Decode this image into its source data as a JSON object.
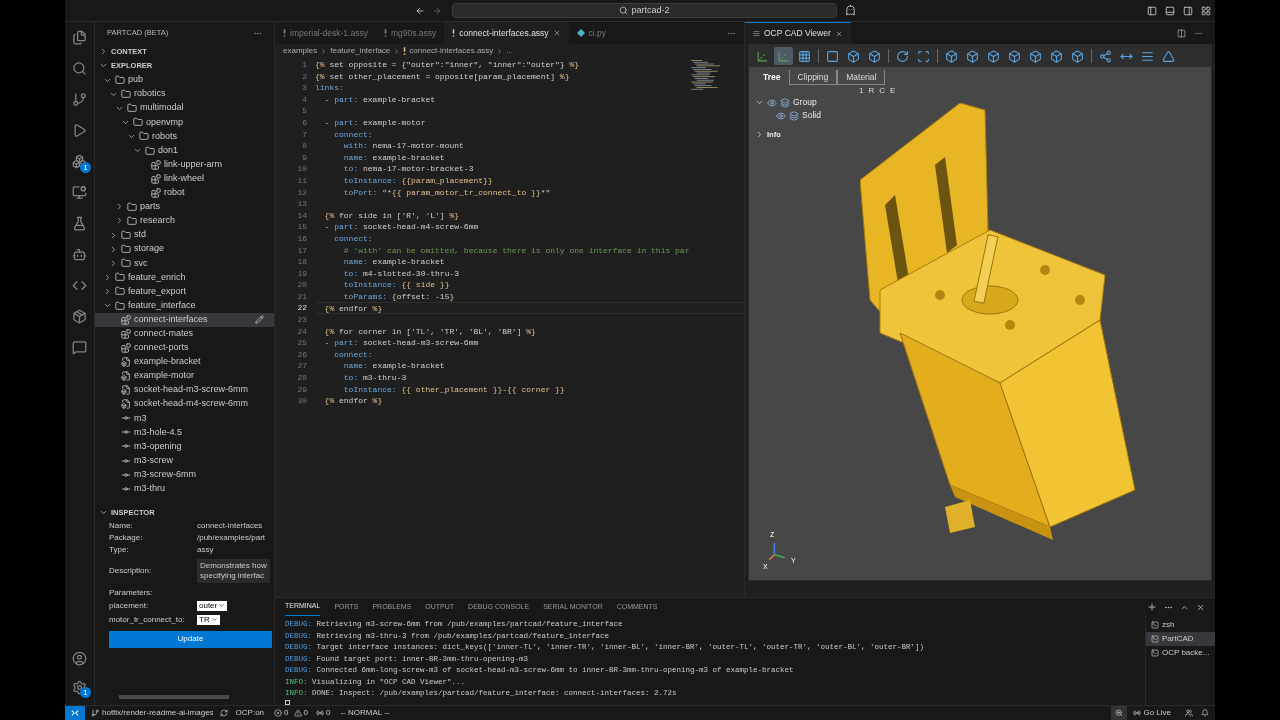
{
  "title_bar": {
    "search": "partcad-2"
  },
  "activity_bar": {
    "extensions_badge": "1",
    "settings_badge": "1"
  },
  "sidebar": {
    "title": "PARTCAD (BETA)",
    "sections": [
      {
        "label": "CONTEXT",
        "expanded": false
      },
      {
        "label": "EXPLORER",
        "expanded": true
      }
    ],
    "tree": [
      {
        "label": "pub",
        "kind": "folder",
        "expanded": true,
        "selected": false,
        "children": [
          {
            "label": "robotics",
            "kind": "folder",
            "expanded": true,
            "selected": false,
            "children": [
              {
                "label": "multimodal",
                "kind": "folder",
                "expanded": true,
                "selected": false,
                "children": [
                  {
                    "label": "openvmp",
                    "kind": "folder",
                    "expanded": true,
                    "selected": false,
                    "children": [
                      {
                        "label": "robots",
                        "kind": "folder",
                        "expanded": true,
                        "selected": false,
                        "children": [
                          {
                            "label": "don1",
                            "kind": "folder",
                            "expanded": true,
                            "selected": false,
                            "children": [
                              {
                                "label": "link-upper-arm",
                                "kind": "assembly",
                                "selected": false
                              },
                              {
                                "label": "link-wheel",
                                "kind": "assembly",
                                "selected": false
                              },
                              {
                                "label": "robot",
                                "kind": "assembly",
                                "selected": false
                              }
                            ]
                          }
                        ]
                      }
                    ]
                  }
                ]
              },
              {
                "label": "parts",
                "kind": "folder",
                "expanded": false,
                "selected": false
              },
              {
                "label": "research",
                "kind": "folder",
                "expanded": false,
                "selected": false
              }
            ]
          },
          {
            "label": "std",
            "kind": "folder",
            "expanded": false,
            "selected": false
          },
          {
            "label": "storage",
            "kind": "folder",
            "expanded": false,
            "selected": false
          },
          {
            "label": "svc",
            "kind": "folder",
            "expanded": false,
            "selected": false
          }
        ]
      },
      {
        "label": "feature_enrich",
        "kind": "folder",
        "expanded": false,
        "selected": false
      },
      {
        "label": "feature_export",
        "kind": "folder",
        "expanded": false,
        "selected": false
      },
      {
        "label": "feature_interface",
        "kind": "folder",
        "expanded": true,
        "selected": false,
        "children": [
          {
            "label": "connect-interfaces",
            "kind": "assembly",
            "selected": true
          },
          {
            "label": "connect-mates",
            "kind": "assembly",
            "selected": false
          },
          {
            "label": "connect-ports",
            "kind": "assembly",
            "selected": false
          },
          {
            "label": "example-bracket",
            "kind": "part",
            "selected": false
          },
          {
            "label": "example-motor",
            "kind": "part",
            "selected": false
          },
          {
            "label": "socket-head-m3-screw-6mm",
            "kind": "part",
            "selected": false
          },
          {
            "label": "socket-head-m4-screw-6mm",
            "kind": "part",
            "selected": false
          },
          {
            "label": "m3",
            "kind": "interface",
            "selected": false
          },
          {
            "label": "m3-hole-4.5",
            "kind": "interface",
            "selected": false
          },
          {
            "label": "m3-opening",
            "kind": "interface",
            "selected": false
          },
          {
            "label": "m3-screw",
            "kind": "interface",
            "selected": false
          },
          {
            "label": "m3-screw-6mm",
            "kind": "interface",
            "selected": false
          },
          {
            "label": "m3-thru",
            "kind": "interface",
            "selected": false
          }
        ]
      }
    ],
    "inspector": {
      "label": "INSPECTOR",
      "expanded": true,
      "fields": [
        {
          "label": "Name:",
          "value": "connect-interfaces"
        },
        {
          "label": "Package:",
          "value": "/pub/examples/part"
        },
        {
          "label": "Type:",
          "value": "assy"
        }
      ],
      "description": {
        "label": "Description:",
        "lines": [
          "Demonstrates how",
          "specifying interfac"
        ]
      },
      "parameters_label": "Parameters:",
      "parameters": [
        {
          "label": "placement:",
          "value": "outer"
        },
        {
          "label": "motor_tr_connect_to:",
          "value": "TR"
        }
      ],
      "button": "Update"
    }
  },
  "editor": {
    "tabs": [
      {
        "label": "imperial-desk-1.assy",
        "kind": "yaml",
        "selected": false
      },
      {
        "label": "mg90s.assy",
        "kind": "yaml",
        "selected": false
      },
      {
        "label": "connect-interfaces.assy",
        "kind": "yaml",
        "selected": true
      },
      {
        "label": "ci.py",
        "kind": "python",
        "selected": false
      }
    ],
    "breadcrumbs": [
      {
        "label": "examples",
        "kind": "folder"
      },
      {
        "label": "feature_interface",
        "kind": "folder"
      },
      {
        "label": "connect-interfaces.assy",
        "kind": "yaml"
      },
      {
        "label": "...",
        "kind": "folder"
      }
    ],
    "lines": [
      {
        "n": "1",
        "current": false,
        "tokens": [
          {
            "kind": "tpl",
            "text": "{%"
          },
          {
            "kind": "text",
            "text": " set opposite = {\"outer\":\"inner\", \"inner\":\"outer\"} "
          },
          {
            "kind": "tpl",
            "text": "%}"
          }
        ]
      },
      {
        "n": "2",
        "current": false,
        "tokens": [
          {
            "kind": "tpl",
            "text": "{%"
          },
          {
            "kind": "text",
            "text": " set other_placement = opposite[param_placement] "
          },
          {
            "kind": "tpl",
            "text": "%}"
          }
        ]
      },
      {
        "n": "3",
        "current": false,
        "tokens": [
          {
            "kind": "key",
            "text": "links:"
          }
        ]
      },
      {
        "n": "4",
        "current": false,
        "tokens": [
          {
            "kind": "text",
            "text": "  - "
          },
          {
            "kind": "key",
            "text": "part:"
          },
          {
            "kind": "text",
            "text": " example-bracket"
          }
        ]
      },
      {
        "n": "5",
        "current": false
      },
      {
        "n": "6",
        "current": false,
        "tokens": [
          {
            "kind": "text",
            "text": "  - "
          },
          {
            "kind": "key",
            "text": "part:"
          },
          {
            "kind": "text",
            "text": " example-motor"
          }
        ]
      },
      {
        "n": "7",
        "current": false,
        "tokens": [
          {
            "kind": "key",
            "text": "    connect:"
          }
        ]
      },
      {
        "n": "8",
        "current": false,
        "tokens": [
          {
            "kind": "key",
            "text": "      with:"
          },
          {
            "kind": "text",
            "text": " nema-17-motor-mount"
          }
        ]
      },
      {
        "n": "9",
        "current": false,
        "tokens": [
          {
            "kind": "key",
            "text": "      name:"
          },
          {
            "kind": "text",
            "text": " example-bracket"
          }
        ]
      },
      {
        "n": "10",
        "current": false,
        "tokens": [
          {
            "kind": "key",
            "text": "      to:"
          },
          {
            "kind": "text",
            "text": " nema-17-motor-bracket-3"
          }
        ]
      },
      {
        "n": "11",
        "current": false,
        "tokens": [
          {
            "kind": "key",
            "text": "      toInstance:"
          },
          {
            "kind": "tpl",
            "text": " {{param_placement}}"
          }
        ]
      },
      {
        "n": "12",
        "current": false,
        "tokens": [
          {
            "kind": "key",
            "text": "      toPort:"
          },
          {
            "kind": "text",
            "text": " \"*"
          },
          {
            "kind": "tpl",
            "text": "{{ param_motor_tr_connect_to }}"
          },
          {
            "kind": "text",
            "text": "*\""
          }
        ]
      },
      {
        "n": "13",
        "current": false
      },
      {
        "n": "14",
        "current": false,
        "tokens": [
          {
            "kind": "tpl",
            "text": "  {%"
          },
          {
            "kind": "text",
            "text": " for side in ['R', 'L'] "
          },
          {
            "kind": "tpl",
            "text": "%}"
          }
        ]
      },
      {
        "n": "15",
        "current": false,
        "tokens": [
          {
            "kind": "text",
            "text": "  - "
          },
          {
            "kind": "key",
            "text": "part:"
          },
          {
            "kind": "text",
            "text": " socket-head-m4-screw-6mm"
          }
        ]
      },
      {
        "n": "16",
        "current": false,
        "tokens": [
          {
            "kind": "key",
            "text": "    connect:"
          }
        ]
      },
      {
        "n": "17",
        "current": false,
        "tokens": [
          {
            "kind": "comment",
            "text": "      # 'with' can be omitted, because there is only one interface in this par"
          }
        ]
      },
      {
        "n": "18",
        "current": false,
        "tokens": [
          {
            "kind": "key",
            "text": "      name:"
          },
          {
            "kind": "text",
            "text": " example-bracket"
          }
        ]
      },
      {
        "n": "19",
        "current": false,
        "tokens": [
          {
            "kind": "key",
            "text": "      to:"
          },
          {
            "kind": "text",
            "text": " m4-slotted-30-thru-3"
          }
        ]
      },
      {
        "n": "20",
        "current": false,
        "tokens": [
          {
            "kind": "key",
            "text": "      toInstance:"
          },
          {
            "kind": "tpl",
            "text": " {{ side }}"
          }
        ]
      },
      {
        "n": "21",
        "current": false,
        "tokens": [
          {
            "kind": "key",
            "text": "      toParams:"
          },
          {
            "kind": "tpl",
            "text": " {"
          },
          {
            "kind": "text",
            "text": "offset: -15"
          },
          {
            "kind": "tpl",
            "text": "}"
          }
        ]
      },
      {
        "n": "22",
        "current": true,
        "tokens": [
          {
            "kind": "tpl",
            "text": "  {%"
          },
          {
            "kind": "text",
            "text": " endfor "
          },
          {
            "kind": "tpl",
            "text": "%}"
          }
        ]
      },
      {
        "n": "23",
        "current": false
      },
      {
        "n": "24",
        "current": false,
        "tokens": [
          {
            "kind": "tpl",
            "text": "  {%"
          },
          {
            "kind": "text",
            "text": " for corner in ['TL', 'TR', 'BL', 'BR'] "
          },
          {
            "kind": "tpl",
            "text": "%}"
          }
        ]
      },
      {
        "n": "25",
        "current": false,
        "tokens": [
          {
            "kind": "text",
            "text": "  - "
          },
          {
            "kind": "key",
            "text": "part:"
          },
          {
            "kind": "text",
            "text": " socket-head-m3-screw-6mm"
          }
        ]
      },
      {
        "n": "26",
        "current": false,
        "tokens": [
          {
            "kind": "key",
            "text": "    connect:"
          }
        ]
      },
      {
        "n": "27",
        "current": false,
        "tokens": [
          {
            "kind": "key",
            "text": "      name:"
          },
          {
            "kind": "text",
            "text": " example-bracket"
          }
        ]
      },
      {
        "n": "28",
        "current": false,
        "tokens": [
          {
            "kind": "key",
            "text": "      to:"
          },
          {
            "kind": "text",
            "text": " m3-thru-3"
          }
        ]
      },
      {
        "n": "29",
        "current": false,
        "tokens": [
          {
            "kind": "key",
            "text": "      toInstance:"
          },
          {
            "kind": "tpl",
            "text": " {{ other_placement }}"
          },
          {
            "kind": "text",
            "text": "-"
          },
          {
            "kind": "tpl",
            "text": "{{ corner }}"
          }
        ]
      },
      {
        "n": "30",
        "current": false,
        "tokens": [
          {
            "kind": "tpl",
            "text": "  {%"
          },
          {
            "kind": "text",
            "text": " endfor "
          },
          {
            "kind": "tpl",
            "text": "%}"
          }
        ]
      }
    ]
  },
  "viewer": {
    "tab": "OCP CAD Viewer",
    "toolbar": [
      {
        "selected": false
      },
      {
        "selected": true
      },
      {
        "selected": false
      },
      {
        "selected": false
      },
      {
        "selected": false
      },
      {
        "selected": false
      },
      {
        "selected": false
      },
      {
        "selected": false
      },
      {
        "selected": false
      },
      {
        "selected": false
      },
      {
        "selected": false
      },
      {
        "selected": false
      },
      {
        "selected": false
      },
      {
        "selected": false
      },
      {
        "selected": false
      },
      {
        "selected": false
      },
      {
        "selected": false
      },
      {
        "selected": false
      },
      {
        "selected": false
      }
    ],
    "tabs": [
      {
        "label": "Tree",
        "selected": true
      },
      {
        "label": "Clipping",
        "selected": false
      },
      {
        "label": "Material",
        "selected": false
      }
    ],
    "flags": [
      "1",
      "R",
      "C",
      "E"
    ],
    "tree": [
      {
        "label": "Group",
        "expanded": true,
        "children": [
          {
            "label": "Solid"
          }
        ]
      }
    ],
    "info": {
      "label": "Info",
      "expanded": false
    },
    "axes": [
      "Z",
      "X",
      "Y"
    ]
  },
  "panel": {
    "tabs": [
      {
        "label": "TERMINAL",
        "selected": true
      },
      {
        "label": "PORTS",
        "selected": false
      },
      {
        "label": "PROBLEMS",
        "selected": false
      },
      {
        "label": "OUTPUT",
        "selected": false
      },
      {
        "label": "DEBUG CONSOLE",
        "selected": false
      },
      {
        "label": "SERIAL MONITOR",
        "selected": false
      },
      {
        "label": "COMMENTS",
        "selected": false
      }
    ],
    "lines": [
      {
        "kind": "debug",
        "level": "DEBUG:",
        "text": "Retrieving m3-screw-6mm from /pub/examples/partcad/feature_interface"
      },
      {
        "kind": "debug",
        "level": "DEBUG:",
        "text": "Retrieving m3-thru-3 from /pub/examples/partcad/feature_interface"
      },
      {
        "kind": "debug",
        "level": "DEBUG:",
        "text": "Target interface instances: dict_keys(['inner-TL', 'inner-TR', 'inner-BL', 'inner-BR', 'outer-TL', 'outer-TR', 'outer-BL', 'outer-BR'])"
      },
      {
        "kind": "debug",
        "level": "DEBUG:",
        "text": "Found target port: inner-BR-3mm-thru-opening-m3"
      },
      {
        "kind": "debug",
        "level": "DEBUG:",
        "text": "Connected 6mm-long-screw-m3 of socket-head-m3-screw-6mm to inner-BR-3mm-thru-opening-m3 of example-bracket"
      },
      {
        "kind": "info",
        "level": "INFO:",
        "text": "Visualizing in \"OCP CAD Viewer\"..."
      },
      {
        "kind": "info",
        "level": "INFO:",
        "text": "DONE: Inspect: /pub/examples/partcad/feature_interface: connect-interfaces: 2.72s"
      }
    ],
    "sessions": [
      {
        "label": "zsh",
        "selected": false
      },
      {
        "label": "PartCAD",
        "selected": true
      },
      {
        "label": "OCP backe...",
        "selected": false
      }
    ]
  },
  "status_bar": {
    "branch": "hotfix/render-readme-ai-images",
    "ocp": "OCP:on",
    "errors": "0",
    "warnings": "0",
    "ports": "0",
    "mode": "-- NORMAL --",
    "go_live": "Go Live"
  }
}
